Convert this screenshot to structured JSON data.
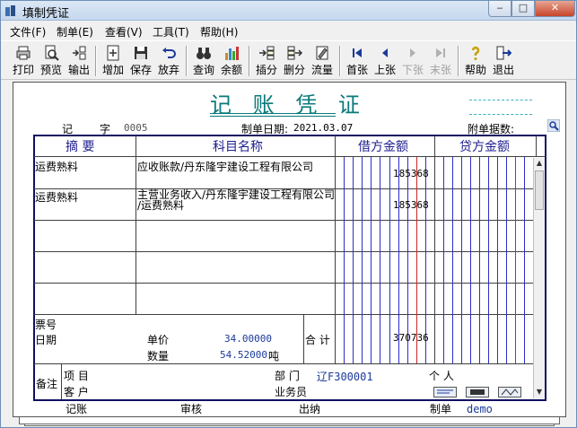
{
  "window": {
    "title": "填制凭证",
    "min": "‒",
    "max": "□",
    "close": "✕"
  },
  "menu": [
    "文件(F)",
    "制单(E)",
    "查看(V)",
    "工具(T)",
    "帮助(H)"
  ],
  "toolbar": [
    {
      "label": "打印",
      "icon": "printer-icon",
      "enabled": true
    },
    {
      "label": "预览",
      "icon": "preview-icon",
      "enabled": true
    },
    {
      "label": "输出",
      "icon": "output-icon",
      "enabled": true
    },
    {
      "label": "增加",
      "icon": "add-icon",
      "enabled": true
    },
    {
      "label": "保存",
      "icon": "save-icon",
      "enabled": true
    },
    {
      "label": "放弃",
      "icon": "undo-icon",
      "enabled": true
    },
    {
      "label": "查询",
      "icon": "binoculars-icon",
      "enabled": true
    },
    {
      "label": "余额",
      "icon": "balance-chart-icon",
      "enabled": true
    },
    {
      "label": "插分",
      "icon": "insert-row-icon",
      "enabled": true
    },
    {
      "label": "删分",
      "icon": "delete-row-icon",
      "enabled": true
    },
    {
      "label": "流量",
      "icon": "flow-icon",
      "enabled": true
    },
    {
      "label": "首张",
      "icon": "first-icon",
      "enabled": true
    },
    {
      "label": "上张",
      "icon": "prev-icon",
      "enabled": true
    },
    {
      "label": "下张",
      "icon": "next-icon",
      "enabled": false
    },
    {
      "label": "末张",
      "icon": "last-icon",
      "enabled": false
    },
    {
      "label": "帮助",
      "icon": "help-icon",
      "enabled": true
    },
    {
      "label": "退出",
      "icon": "exit-icon",
      "enabled": true
    }
  ],
  "voucher": {
    "title": "记 账 凭 证",
    "type_label": "记",
    "number_label": "字",
    "number": "0005",
    "date_label": "制单日期:",
    "date": "2021.03.07",
    "attach_label": "附单据数:",
    "headers": {
      "summary": "摘 要",
      "account": "科目名称",
      "debit": "借方金额",
      "credit": "贷方金额"
    },
    "rows": [
      {
        "summary": "运费熟料",
        "account": "应收账款/丹东隆宇建设工程有限公司",
        "account2": "",
        "debit": "185368",
        "credit": ""
      },
      {
        "summary": "运费熟料",
        "account": "主营业务收入/丹东隆宇建设工程有限公司",
        "account2": "/运费熟料",
        "debit": "185368",
        "credit": ""
      }
    ],
    "bill_no_label": "票号",
    "date2_label": "日期",
    "unit_price_label": "单价",
    "unit_price": "34.00000",
    "qty_label": "数量",
    "qty": "54.52000",
    "qty_unit": "吨",
    "total_label": "合 计",
    "total_debit": "370736",
    "note_label": "备注",
    "project_label": "项  目",
    "customer_label": "客  户",
    "dept_label": "部  门",
    "dept_value": "辽F300001",
    "person_label": "个  人",
    "salesman_label": "业务员",
    "footer": {
      "bookkeep": "记账",
      "review": "审核",
      "cashier": "出纳",
      "maker_label": "制单",
      "maker": "demo"
    }
  }
}
